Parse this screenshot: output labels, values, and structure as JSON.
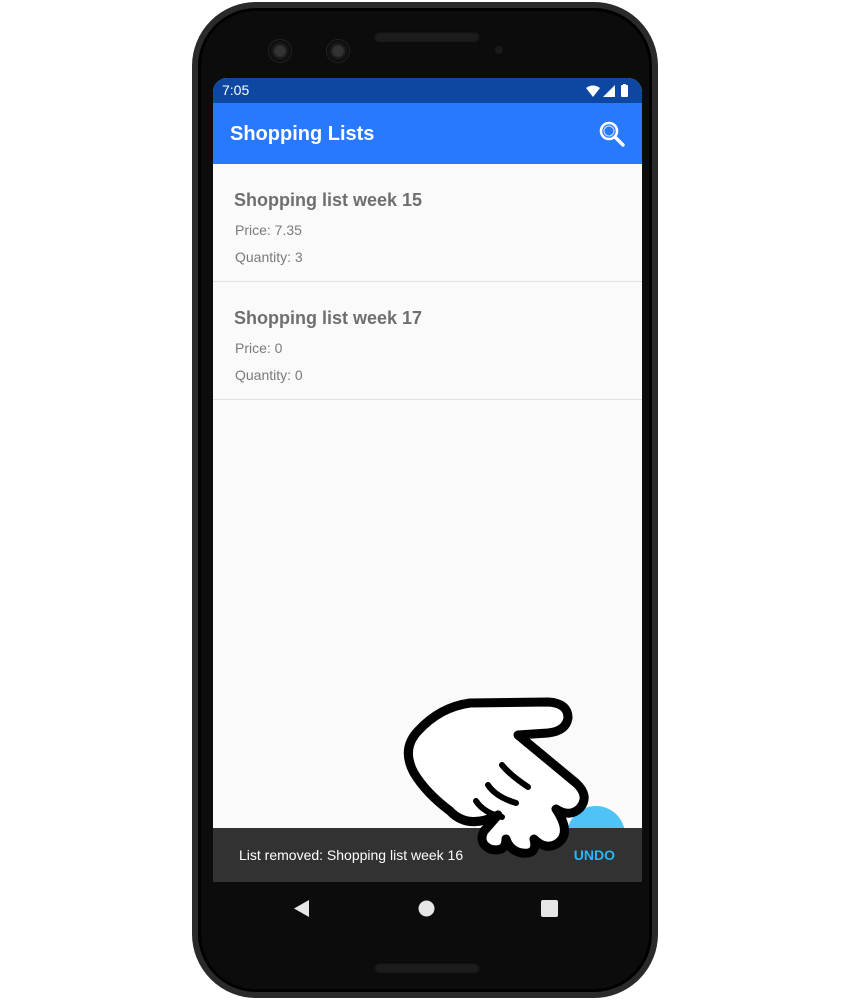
{
  "status_bar": {
    "time": "7:05"
  },
  "app_bar": {
    "title": "Shopping Lists"
  },
  "lists": [
    {
      "title": "Shopping list week 15",
      "price": "Price: 7.35",
      "quantity": "Quantity: 3"
    },
    {
      "title": "Shopping list week 17",
      "price": "Price: 0",
      "quantity": "Quantity: 0"
    }
  ],
  "snackbar": {
    "message": "List removed: Shopping list week 16",
    "action": "UNDO"
  },
  "colors": {
    "status_bar": "#0d47a1",
    "app_bar": "#2979ff",
    "fab": "#4fc3f7",
    "snackbar": "#323232",
    "snackbar_action": "#29b6f6"
  },
  "icons": [
    "search-icon",
    "wifi-icon",
    "signal-icon",
    "battery-icon",
    "back-icon",
    "home-icon",
    "recents-icon",
    "pointing-hand-icon"
  ]
}
